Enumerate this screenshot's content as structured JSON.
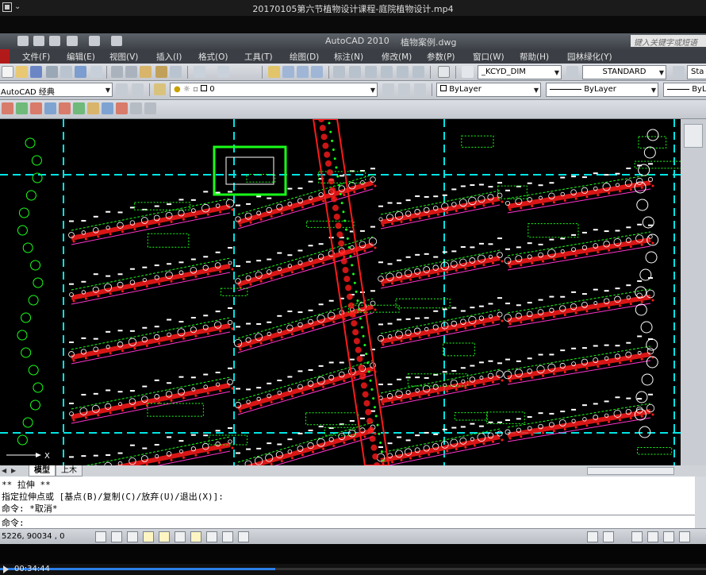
{
  "player": {
    "title": "20170105第六节植物设计课程-庭院植物设计.mp4",
    "time": "00:34:44",
    "progress_fraction": 0.39
  },
  "cad": {
    "app_name": "AutoCAD 2010",
    "file_name": "植物案例.dwg",
    "search_placeholder": "键入关键字或短语",
    "menus": [
      "文件(F)",
      "编辑(E)",
      "视图(V)",
      "插入(I)",
      "格式(O)",
      "工具(T)",
      "绘图(D)",
      "标注(N)",
      "修改(M)",
      "参数(P)",
      "窗口(W)",
      "帮助(H)",
      "园林绿化(Y)"
    ],
    "dim_style": "_KCYD_DIM",
    "text_style": "STANDARD",
    "text_style_short": "Sta",
    "workspace": "AutoCAD 经典",
    "layer": "0",
    "color": "ByLayer",
    "linetype": "ByLayer",
    "lineweight": "ByL"
  },
  "tabs": [
    "模型",
    "上木"
  ],
  "command": {
    "lines": [
      "** 拉伸 **",
      "指定拉伸点或 [基点(B)/复制(C)/放弃(U)/退出(X)]:",
      "命令: *取消*"
    ],
    "prompt": "命令:"
  },
  "status": {
    "coords": "5226, 90034 , 0"
  },
  "ucs": {
    "x_label": "X"
  },
  "colors": {
    "green": "#19ff19",
    "red": "#ff1a1a",
    "cyan": "#00e5e5",
    "magenta": "#ff33cc",
    "white": "#ffffff"
  }
}
